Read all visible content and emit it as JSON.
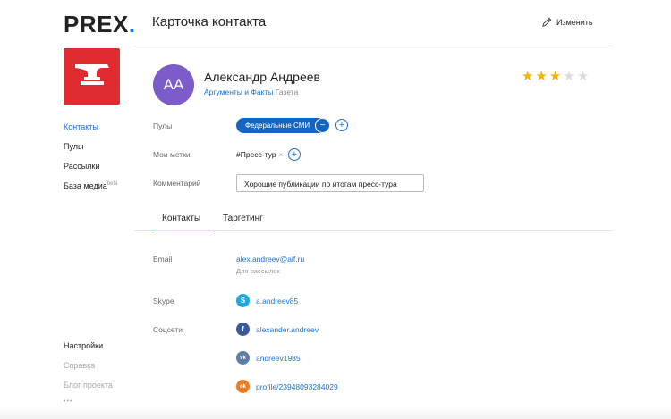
{
  "logo": {
    "text": "PREX",
    "dot": "."
  },
  "sidebar": {
    "items": [
      {
        "label": "Контакты",
        "state": "active"
      },
      {
        "label": "Пулы",
        "state": "normal"
      },
      {
        "label": "Рассылки",
        "state": "normal"
      },
      {
        "label": "База медиа",
        "badge": "beta",
        "state": "normal"
      }
    ],
    "bottom": [
      {
        "label": "Настройки",
        "state": "normal"
      },
      {
        "label": "Справка",
        "state": "muted"
      },
      {
        "label": "Блог проекта",
        "state": "muted"
      },
      {
        "label": "•••",
        "state": "muted"
      }
    ]
  },
  "header": {
    "title": "Карточка контакта",
    "edit_label": "Изменить"
  },
  "profile": {
    "initials": "AA",
    "name": "Александр Андреев",
    "org_link": "Аргументы и Факты",
    "org_type": "Газета",
    "rating": 3,
    "rating_max": 5
  },
  "fields": {
    "pools_label": "Пулы",
    "pool_value": "Федеральные СМИ",
    "tags_label": "Мои метки",
    "tag_value": "#Пресс-тур",
    "comment_label": "Комментарий",
    "comment_value": "Хорошие публикации по итогам пресс-тура"
  },
  "tabs": [
    {
      "label": "Контакты",
      "active": true
    },
    {
      "label": "Таргетинг",
      "active": false
    }
  ],
  "contacts": {
    "email_label": "Email",
    "email": "alex.andreev@aif.ru",
    "email_note": "Для рассылок",
    "skype_label": "Skype",
    "skype": "a.andreev85",
    "social_label": "Соцсети",
    "social": [
      {
        "icon": "facebook-icon",
        "letter": "f",
        "color": "#3b5998",
        "value": "alexander.andreev"
      },
      {
        "icon": "vk-icon",
        "letter": "vk",
        "color": "#5b7fa6",
        "value": "andreev1985"
      },
      {
        "icon": "odnoklassniki-icon",
        "letter": "ok",
        "color": "#f07b1f",
        "value": "profile/23948093284029"
      }
    ]
  },
  "colors": {
    "accent": "#1a73d9",
    "brand_tile": "#e02b2f",
    "avatar": "#7b5cc8",
    "star": "#f5b400"
  }
}
